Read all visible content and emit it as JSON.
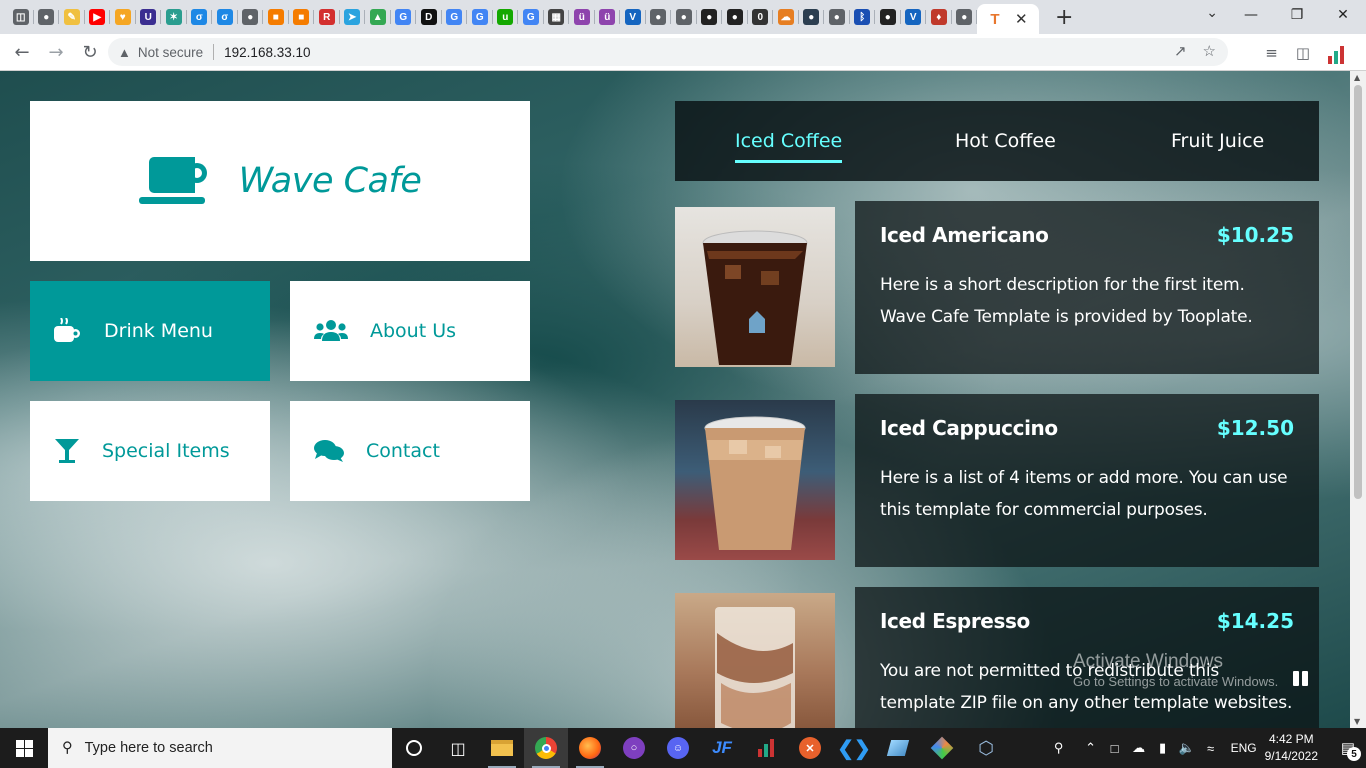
{
  "browser": {
    "tab_favicons": [
      {
        "icon": "page-icon",
        "color": "#5f6368",
        "glyph": "◫"
      },
      {
        "icon": "globe-icon",
        "color": "#5f6368",
        "glyph": "●"
      },
      {
        "icon": "edit-icon",
        "color": "#f0c040",
        "glyph": "✎"
      },
      {
        "icon": "youtube-icon",
        "color": "#ff0000",
        "glyph": "▶"
      },
      {
        "icon": "shield-icon",
        "color": "#f5a623",
        "glyph": "♥"
      },
      {
        "icon": "u-icon",
        "color": "#3b2e91",
        "glyph": "U"
      },
      {
        "icon": "spark-icon",
        "color": "#2a9d8f",
        "glyph": "✶"
      },
      {
        "icon": "drop-icon",
        "color": "#1e88e5",
        "glyph": "σ"
      },
      {
        "icon": "drop-icon",
        "color": "#1e88e5",
        "glyph": "σ"
      },
      {
        "icon": "globe-icon",
        "color": "#5f6368",
        "glyph": "●"
      },
      {
        "icon": "box-icon",
        "color": "#f57c00",
        "glyph": "■"
      },
      {
        "icon": "box-icon",
        "color": "#f57c00",
        "glyph": "■"
      },
      {
        "icon": "r-icon",
        "color": "#d32f2f",
        "glyph": "R"
      },
      {
        "icon": "telegram-icon",
        "color": "#2aa3df",
        "glyph": "➤"
      },
      {
        "icon": "drive-icon",
        "color": "#34a853",
        "glyph": "▲"
      },
      {
        "icon": "google-icon",
        "color": "#4285f4",
        "glyph": "G"
      },
      {
        "icon": "dev-icon",
        "color": "#111111",
        "glyph": "D"
      },
      {
        "icon": "google-icon",
        "color": "#4285f4",
        "glyph": "G"
      },
      {
        "icon": "google-icon",
        "color": "#4285f4",
        "glyph": "G"
      },
      {
        "icon": "upwork-icon",
        "color": "#14a800",
        "glyph": "u"
      },
      {
        "icon": "google-icon",
        "color": "#4285f4",
        "glyph": "G"
      },
      {
        "icon": "grid-icon",
        "color": "#444444",
        "glyph": "▦"
      },
      {
        "icon": "u-circle-icon",
        "color": "#8e44ad",
        "glyph": "ü"
      },
      {
        "icon": "u-circle-icon",
        "color": "#8e44ad",
        "glyph": "ü"
      },
      {
        "icon": "v-icon",
        "color": "#1565c0",
        "glyph": "V"
      },
      {
        "icon": "globe-icon",
        "color": "#5f6368",
        "glyph": "●"
      },
      {
        "icon": "globe-icon",
        "color": "#5f6368",
        "glyph": "●"
      },
      {
        "icon": "github-icon",
        "color": "#222222",
        "glyph": "●"
      },
      {
        "icon": "github-icon",
        "color": "#222222",
        "glyph": "●"
      },
      {
        "icon": "zero-icon",
        "color": "#333333",
        "glyph": "0"
      },
      {
        "icon": "cloud-icon",
        "color": "#e67e22",
        "glyph": "☁"
      },
      {
        "icon": "globe-icon",
        "color": "#2c3e50",
        "glyph": "●"
      },
      {
        "icon": "globe-icon",
        "color": "#5f6368",
        "glyph": "●"
      },
      {
        "icon": "bluetooth-icon",
        "color": "#1a4fb3",
        "glyph": "ᛒ"
      },
      {
        "icon": "github-icon",
        "color": "#222222",
        "glyph": "●"
      },
      {
        "icon": "v-icon",
        "color": "#1565c0",
        "glyph": "V"
      },
      {
        "icon": "rocket-icon",
        "color": "#c0392b",
        "glyph": "♦"
      },
      {
        "icon": "globe-icon",
        "color": "#5f6368",
        "glyph": "●"
      }
    ],
    "active_tab": {
      "favicon": "T",
      "close": "✕"
    },
    "new_tab": "+",
    "window_controls": {
      "minimize": "—",
      "maximize": "❐",
      "close": "✕"
    },
    "tab_search": "⌄",
    "address": {
      "security": "Not secure",
      "url": "192.168.33.10"
    }
  },
  "site": {
    "title": "Wave Cafe",
    "nav": [
      {
        "label": "Drink Menu",
        "active": true
      },
      {
        "label": "About Us",
        "active": false
      },
      {
        "label": "Special Items",
        "active": false
      },
      {
        "label": "Contact",
        "active": false
      }
    ],
    "menu_tabs": [
      {
        "label": "Iced Coffee",
        "active": true
      },
      {
        "label": "Hot Coffee",
        "active": false
      },
      {
        "label": "Fruit Juice",
        "active": false
      }
    ],
    "items": [
      {
        "name": "Iced Americano",
        "price": "$10.25",
        "desc_lines": [
          "Here is a short description for the first item.",
          "Wave Cafe Template is provided by Tooplate."
        ]
      },
      {
        "name": "Iced Cappuccino",
        "price": "$12.50",
        "desc_lines": [
          "Here is a list of 4 items or add more. You can use",
          "this template for commercial purposes."
        ]
      },
      {
        "name": "Iced Espresso",
        "price": "$14.25",
        "desc_lines": [
          "You are not permitted to redistribute this",
          "template ZIP file on any other template websites."
        ]
      }
    ],
    "accent": "#009999",
    "highlight": "#66ffff"
  },
  "watermark": {
    "line1": "Activate Windows",
    "line2": "Go to Settings to activate Windows."
  },
  "taskbar": {
    "search_placeholder": "Type here to search",
    "language": "ENG",
    "time": "4:42 PM",
    "date": "9/14/2022",
    "notifications": "5"
  }
}
